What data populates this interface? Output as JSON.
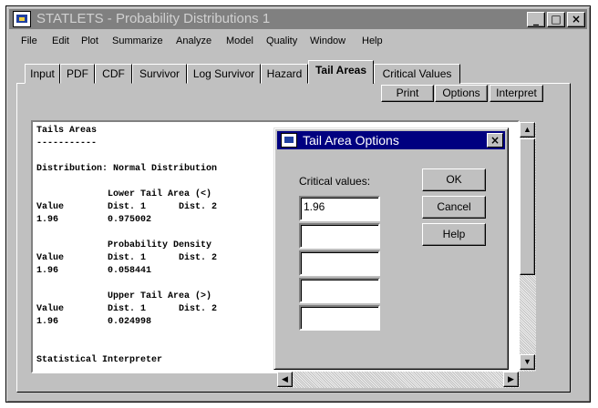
{
  "window": {
    "title": "STATLETS - Probability Distributions 1",
    "minimize": "_",
    "maximize": "□",
    "close": "×"
  },
  "menu": [
    "File",
    "Edit",
    "Plot",
    "Summarize",
    "Analyze",
    "Model",
    "Quality",
    "Window",
    "Help"
  ],
  "tabs": [
    "Input",
    "PDF",
    "CDF",
    "Survivor",
    "Log Survivor",
    "Hazard",
    "Tail Areas",
    "Critical Values"
  ],
  "active_tab": "Tail Areas",
  "toolbar": {
    "print": "Print",
    "options": "Options",
    "interpret": "Interpret"
  },
  "output": {
    "lines": [
      "Tails Areas",
      "-----------",
      "",
      "Distribution: Normal Distribution",
      "",
      "             Lower Tail Area (<)",
      "Value        Dist. 1      Dist. 2",
      "1.96         0.975002",
      "",
      "             Probability Density",
      "Value        Dist. 1      Dist. 2",
      "1.96         0.058441",
      "",
      "             Upper Tail Area (>)",
      "Value        Dist. 1      Dist. 2",
      "1.96         0.024998",
      "",
      "",
      "Statistical Interpreter"
    ]
  },
  "scroll": {
    "up": "▲",
    "down": "▼",
    "left": "◀",
    "right": "▶"
  },
  "dialog": {
    "title": "Tail Area Options",
    "close": "×",
    "critical_label": "Critical values:",
    "fields": [
      "1.96",
      "",
      "",
      "",
      ""
    ],
    "ok": "OK",
    "cancel": "Cancel",
    "help": "Help"
  }
}
